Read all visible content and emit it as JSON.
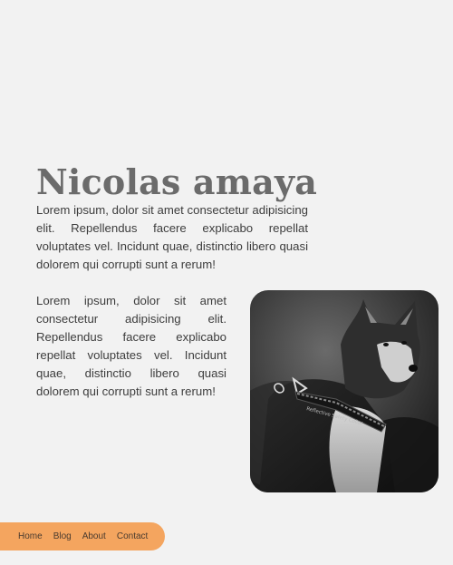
{
  "header": {
    "title": "Nicolas amaya"
  },
  "intro": {
    "paragraph": "Lorem ipsum, dolor sit amet consectetur adipisicing elit. Repellendus facere explicabo repellat voluptates vel. Incidunt quae, distinctio libero quasi dolorem qui corrupti sunt a rerum!"
  },
  "section": {
    "paragraph": "Lorem ipsum, dolor sit amet consectetur adipisicing elit. Repellendus facere explicabo repellat voluptates vel. Incidunt quae, distinctio libero quasi dolorem qui corrupti sunt a rerum!",
    "image": {
      "alt": "Black and white photo of a husky wearing a harness",
      "harness_text": "Reflective Safety Collar"
    }
  },
  "nav": {
    "items": [
      {
        "label": "Home"
      },
      {
        "label": "Blog"
      },
      {
        "label": "About"
      },
      {
        "label": "Contact"
      }
    ]
  },
  "colors": {
    "background": "#f2f2f2",
    "title": "#6b6b6b",
    "body_text": "#3d3d3d",
    "nav_background": "#f4a55f"
  }
}
